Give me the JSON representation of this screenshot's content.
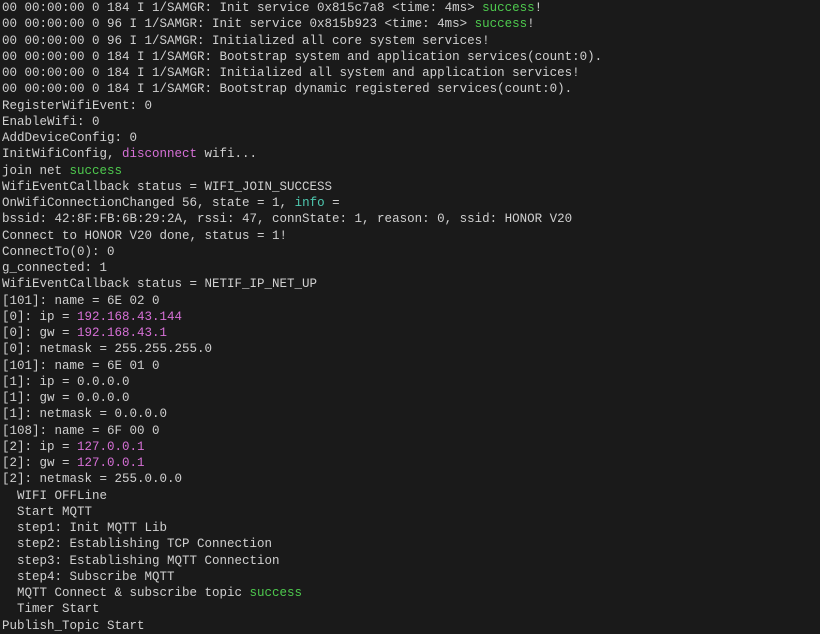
{
  "lines": [
    {
      "segments": [
        {
          "text": "00 00:00:00 0 184 I 1/SAMGR: Init service 0x815c7a8 <time: 4ms> ",
          "cls": "white"
        },
        {
          "text": "success",
          "cls": "green"
        },
        {
          "text": "!",
          "cls": "white"
        }
      ]
    },
    {
      "segments": [
        {
          "text": "00 00:00:00 0 96 I 1/SAMGR: Init service 0x815b923 <time: 4ms> ",
          "cls": "white"
        },
        {
          "text": "success",
          "cls": "green"
        },
        {
          "text": "!",
          "cls": "white"
        }
      ]
    },
    {
      "segments": [
        {
          "text": "00 00:00:00 0 96 I 1/SAMGR: Initialized all core system services!",
          "cls": "white"
        }
      ]
    },
    {
      "segments": [
        {
          "text": "00 00:00:00 0 184 I 1/SAMGR: Bootstrap system and application services(count:0).",
          "cls": "white"
        }
      ]
    },
    {
      "segments": [
        {
          "text": "00 00:00:00 0 184 I 1/SAMGR: Initialized all system and application services!",
          "cls": "white"
        }
      ]
    },
    {
      "segments": [
        {
          "text": "00 00:00:00 0 184 I 1/SAMGR: Bootstrap dynamic registered services(count:0).",
          "cls": "white"
        }
      ]
    },
    {
      "segments": [
        {
          "text": "RegisterWifiEvent: 0",
          "cls": "white"
        }
      ]
    },
    {
      "segments": [
        {
          "text": "EnableWifi: 0",
          "cls": "white"
        }
      ]
    },
    {
      "segments": [
        {
          "text": "AddDeviceConfig: 0",
          "cls": "white"
        }
      ]
    },
    {
      "segments": [
        {
          "text": "InitWifiConfig, ",
          "cls": "white"
        },
        {
          "text": "disconnect",
          "cls": "magenta"
        },
        {
          "text": " wifi...",
          "cls": "white"
        }
      ]
    },
    {
      "segments": [
        {
          "text": "join net ",
          "cls": "white"
        },
        {
          "text": "success",
          "cls": "green"
        }
      ]
    },
    {
      "segments": [
        {
          "text": "WifiEventCallback status = WIFI_JOIN_SUCCESS",
          "cls": "white"
        }
      ]
    },
    {
      "segments": [
        {
          "text": "OnWifiConnectionChanged 56, state = 1, ",
          "cls": "white"
        },
        {
          "text": "info",
          "cls": "cyan"
        },
        {
          "text": " =",
          "cls": "white"
        }
      ]
    },
    {
      "segments": [
        {
          "text": "bssid: 42:8F:FB:6B:29:2A, rssi: 47, connState: 1, reason: 0, ssid: HONOR V20",
          "cls": "white"
        }
      ]
    },
    {
      "segments": [
        {
          "text": "Connect to HONOR V20 done, status = 1!",
          "cls": "white"
        }
      ]
    },
    {
      "segments": [
        {
          "text": "ConnectTo(0): 0",
          "cls": "white"
        }
      ]
    },
    {
      "segments": [
        {
          "text": "g_connected: 1",
          "cls": "white"
        }
      ]
    },
    {
      "segments": [
        {
          "text": "WifiEventCallback status = NETIF_IP_NET_UP",
          "cls": "white"
        }
      ]
    },
    {
      "segments": [
        {
          "text": "[101]: name = 6E 02 0",
          "cls": "white"
        }
      ]
    },
    {
      "segments": [
        {
          "text": "[0]: ip = ",
          "cls": "white"
        },
        {
          "text": "192.168.43.144",
          "cls": "magenta"
        }
      ]
    },
    {
      "segments": [
        {
          "text": "[0]: gw = ",
          "cls": "white"
        },
        {
          "text": "192.168.43.1",
          "cls": "magenta"
        }
      ]
    },
    {
      "segments": [
        {
          "text": "[0]: netmask = 255.255.255.0",
          "cls": "white"
        }
      ]
    },
    {
      "segments": [
        {
          "text": "[101]: name = 6E 01 0",
          "cls": "white"
        }
      ]
    },
    {
      "segments": [
        {
          "text": "[1]: ip = 0.0.0.0",
          "cls": "white"
        }
      ]
    },
    {
      "segments": [
        {
          "text": "[1]: gw = 0.0.0.0",
          "cls": "white"
        }
      ]
    },
    {
      "segments": [
        {
          "text": "[1]: netmask = 0.0.0.0",
          "cls": "white"
        }
      ]
    },
    {
      "segments": [
        {
          "text": "[108]: name = 6F 00 0",
          "cls": "white"
        }
      ]
    },
    {
      "segments": [
        {
          "text": "[2]: ip = ",
          "cls": "white"
        },
        {
          "text": "127.0.0.1",
          "cls": "magenta"
        }
      ]
    },
    {
      "segments": [
        {
          "text": "[2]: gw = ",
          "cls": "white"
        },
        {
          "text": "127.0.0.1",
          "cls": "magenta"
        }
      ]
    },
    {
      "segments": [
        {
          "text": "[2]: netmask = 255.0.0.0",
          "cls": "white"
        }
      ]
    },
    {
      "segments": [
        {
          "text": "  WIFI OFFLine",
          "cls": "white"
        }
      ]
    },
    {
      "segments": [
        {
          "text": "  Start MQTT",
          "cls": "white"
        }
      ]
    },
    {
      "segments": [
        {
          "text": "  step1: Init MQTT Lib",
          "cls": "white"
        }
      ]
    },
    {
      "segments": [
        {
          "text": "  step2: Establishing TCP Connection",
          "cls": "white"
        }
      ]
    },
    {
      "segments": [
        {
          "text": "  step3: Establishing MQTT Connection",
          "cls": "white"
        }
      ]
    },
    {
      "segments": [
        {
          "text": "  step4: Subscribe MQTT",
          "cls": "white"
        }
      ]
    },
    {
      "segments": [
        {
          "text": "  MQTT Connect & subscribe topic ",
          "cls": "white"
        },
        {
          "text": "success",
          "cls": "green"
        }
      ]
    },
    {
      "segments": [
        {
          "text": "  Timer Start",
          "cls": "white"
        }
      ]
    },
    {
      "segments": [
        {
          "text": "Publish_Topic Start",
          "cls": "white"
        }
      ]
    }
  ]
}
